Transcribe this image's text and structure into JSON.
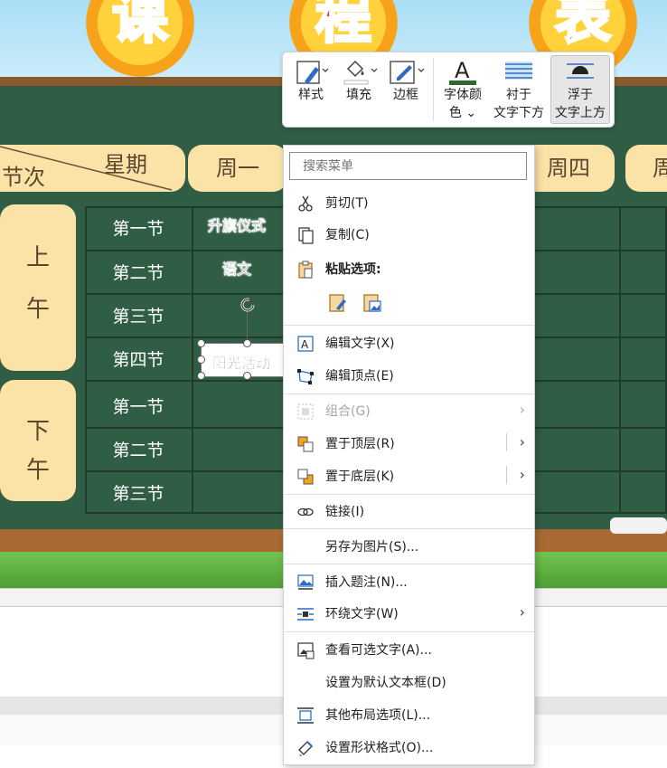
{
  "poster": {
    "title_chars": [
      "课",
      "程",
      "表"
    ],
    "header_left_top": "星期",
    "header_left_bottom": "节次",
    "days": [
      "周一",
      "周四",
      "周"
    ],
    "morning": [
      "上",
      "午"
    ],
    "afternoon": [
      "下",
      "午"
    ],
    "periods": [
      "第一节",
      "第二节",
      "第三节",
      "第四节",
      "第一节",
      "第二节",
      "第三节"
    ],
    "cells": [
      "升旗仪式",
      "语文",
      "阳光活动"
    ]
  },
  "mini_toolbar": {
    "style": "样式",
    "fill": "填充",
    "border": "边框",
    "font_color_line1": "字体颜",
    "font_color_line2": "色",
    "behind_text_line1": "衬于",
    "behind_text_line2": "文字下方",
    "in_front_line1": "浮于",
    "in_front_line2": "文字上方",
    "chevron": "⌄"
  },
  "context_menu": {
    "search_placeholder": "搜索菜单",
    "items": {
      "cut": "剪切(T)",
      "copy": "复制(C)",
      "paste_options": "粘贴选项:",
      "edit_text": "编辑文字(X)",
      "edit_points": "编辑顶点(E)",
      "group": "组合(G)",
      "bring_to_front": "置于顶层(R)",
      "send_to_back": "置于底层(K)",
      "link": "链接(I)",
      "save_as_picture": "另存为图片(S)...",
      "insert_caption": "插入题注(N)...",
      "wrap_text": "环绕文字(W)",
      "view_alt_text": "查看可选文字(A)...",
      "set_default_textbox": "设置为默认文本框(D)",
      "more_layout_options": "其他布局选项(L)...",
      "format_shape": "设置形状格式(O)..."
    },
    "submenu_arrow": "›"
  },
  "colors": {
    "menu_bg": "#ffffff",
    "board_green": "#2f5e45",
    "accent_blue": "#2b6cc4",
    "font_color_bar": "#2e6b2e"
  }
}
